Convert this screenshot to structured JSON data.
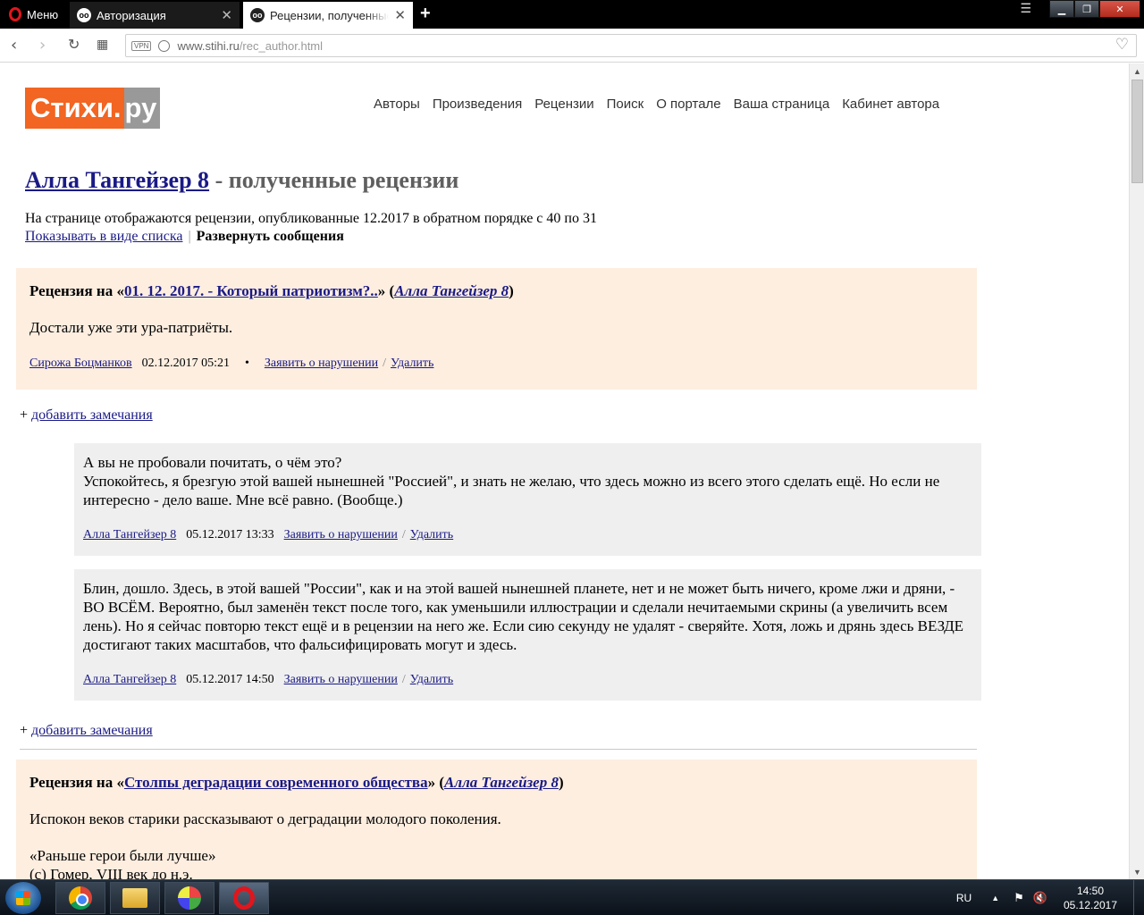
{
  "browser": {
    "menu_label": "Меню",
    "tabs": [
      {
        "title": "Авторизация",
        "active": false
      },
      {
        "title": "Рецензии, полученные автором",
        "active": true
      }
    ],
    "new_tab_icon": "plus-icon",
    "url_host": "www.stihi.ru",
    "url_path": "/rec_author.html",
    "vpn_label": "VPN"
  },
  "site": {
    "logo_part1": "Стихи.",
    "logo_part2": "ру",
    "logo_color": "#f26522",
    "nav": [
      "Авторы",
      "Произведения",
      "Рецензии",
      "Поиск",
      "О портале",
      "Ваша страница",
      "Кабинет автора"
    ]
  },
  "page": {
    "title_author": "Алла Тангейзер 8",
    "title_suffix": " - полученные рецензии",
    "description": "На странице отображаются рецензии, опубликованные 12.2017 в обратном порядке с 40 по 31",
    "show_list_link": "Показывать в виде списка",
    "separator": "|",
    "expand_label": "Развернуть сообщения",
    "add_comment_plus": "+",
    "add_comment": "добавить замечания"
  },
  "reviews": [
    {
      "prefix": "Рецензия на «",
      "work": "01. 12. 2017. - Который патриотизм?..",
      "mid": "» (",
      "author": "Алла Тангейзер 8",
      "suffix": ")",
      "text": "Достали уже эти ура-патриёты.",
      "reviewer": "Сирожа Боцманков",
      "date": "02.12.2017 05:21",
      "bullet": "•",
      "report": "Заявить о нарушении",
      "slash": "/",
      "delete": "Удалить",
      "replies": [
        {
          "text_line1": "А вы не пробовали почитать, о чём это?",
          "text_line2": "Успокойтесь, я брезгую этой вашей нынешней \"Россией\", и знать не желаю, что здесь можно из всего этого сделать ещё. Но если не интересно - дело ваше. Мне всё равно. (Вообще.)",
          "author": "Алла Тангейзер 8",
          "date": "05.12.2017 13:33",
          "report": "Заявить о нарушении",
          "delete": "Удалить"
        },
        {
          "text_line1": "Блин, дошло. Здесь, в этой вашей \"России\", как и на этой вашей нынешней планете, нет и не может быть ничего, кроме лжи и дряни, - ВО ВСЁМ. Вероятно, был заменён текст после того, как уменьшили иллюстрации и сделали нечитаемыми скрины (а увеличить всем лень). Но я сейчас повторю текст ещё и в рецензии на него же. Если сию секунду не удалят - сверяйте. Хотя, ложь и дрянь здесь ВЕЗДЕ достигают таких масштабов, что фальсифицировать могут и здесь.",
          "author": "Алла Тангейзер 8",
          "date": "05.12.2017 14:50",
          "report": "Заявить о нарушении",
          "delete": "Удалить"
        }
      ]
    },
    {
      "prefix": "Рецензия на «",
      "work": "Столпы деградации современного общества",
      "mid": "» (",
      "author": "Алла Тангейзер 8",
      "suffix": ")",
      "text": "Испокон веков старики рассказывают о деградации молодого поколения.",
      "quote_line1": "«Раньше герои были лучше»",
      "quote_line2": "(c) Гомер, VIII век до н.э."
    }
  ],
  "taskbar": {
    "lang": "RU",
    "time": "14:50",
    "date": "05.12.2017",
    "apps": [
      "chrome-icon",
      "explorer-icon",
      "paint-icon",
      "opera-icon"
    ]
  }
}
